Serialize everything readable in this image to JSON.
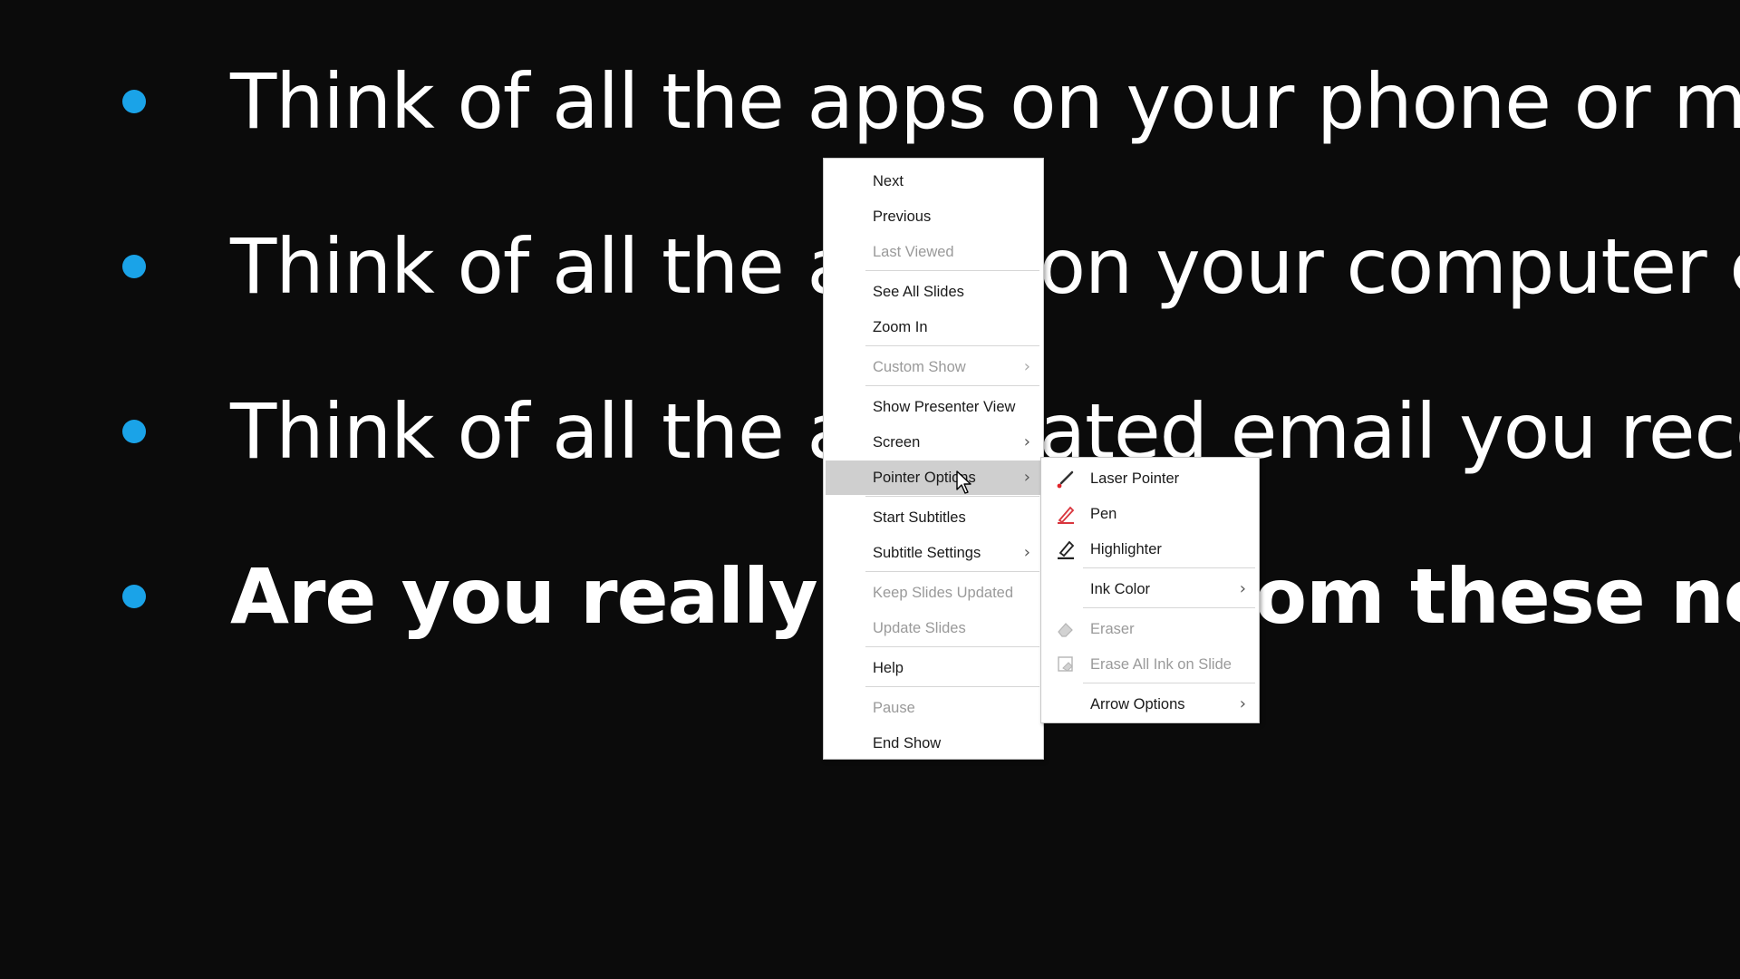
{
  "slide": {
    "bullets": [
      {
        "text": "Think of all the apps on your phone or me",
        "bold": false
      },
      {
        "text": "Think of all the a        on your computer c",
        "bold": false
      },
      {
        "text": "Think of all the a        ated email you rece",
        "bold": false
      },
      {
        "text": "Are you really b              om these not",
        "bold": true
      }
    ]
  },
  "context_menu": {
    "items": [
      {
        "label": "Next",
        "enabled": true
      },
      {
        "label": "Previous",
        "enabled": true
      },
      {
        "label": "Last Viewed",
        "enabled": false
      },
      {
        "label": "See All Slides",
        "enabled": true
      },
      {
        "label": "Zoom In",
        "enabled": true
      },
      {
        "label": "Custom Show",
        "enabled": false,
        "submenu": true
      },
      {
        "label": "Show Presenter View",
        "enabled": true
      },
      {
        "label": "Screen",
        "enabled": true,
        "submenu": true
      },
      {
        "label": "Pointer Options",
        "enabled": true,
        "submenu": true,
        "highlighted": true
      },
      {
        "label": "Start Subtitles",
        "enabled": true
      },
      {
        "label": "Subtitle Settings",
        "enabled": true,
        "submenu": true
      },
      {
        "label": "Keep Slides Updated",
        "enabled": false
      },
      {
        "label": "Update Slides",
        "enabled": false
      },
      {
        "label": "Help",
        "enabled": true
      },
      {
        "label": "Pause",
        "enabled": false
      },
      {
        "label": "End Show",
        "enabled": true
      }
    ],
    "arrow_glyph": "›"
  },
  "pointer_submenu": {
    "items": [
      {
        "label": "Laser Pointer",
        "enabled": true,
        "icon": "laser-pointer-icon"
      },
      {
        "label": "Pen",
        "enabled": true,
        "icon": "pen-icon"
      },
      {
        "label": "Highlighter",
        "enabled": true,
        "icon": "highlighter-icon"
      },
      {
        "label": "Ink Color",
        "enabled": true,
        "submenu": true
      },
      {
        "label": "Eraser",
        "enabled": false,
        "icon": "eraser-icon"
      },
      {
        "label": "Erase All Ink on Slide",
        "enabled": false,
        "icon": "erase-all-ink-icon"
      },
      {
        "label": "Arrow Options",
        "enabled": true,
        "submenu": true
      }
    ]
  },
  "colors": {
    "background": "#0b0b0b",
    "bullet": "#1aa3e8",
    "slide_text": "#ffffff",
    "menu_highlight": "#cfcfcf",
    "disabled_text": "#9a9a9a"
  }
}
